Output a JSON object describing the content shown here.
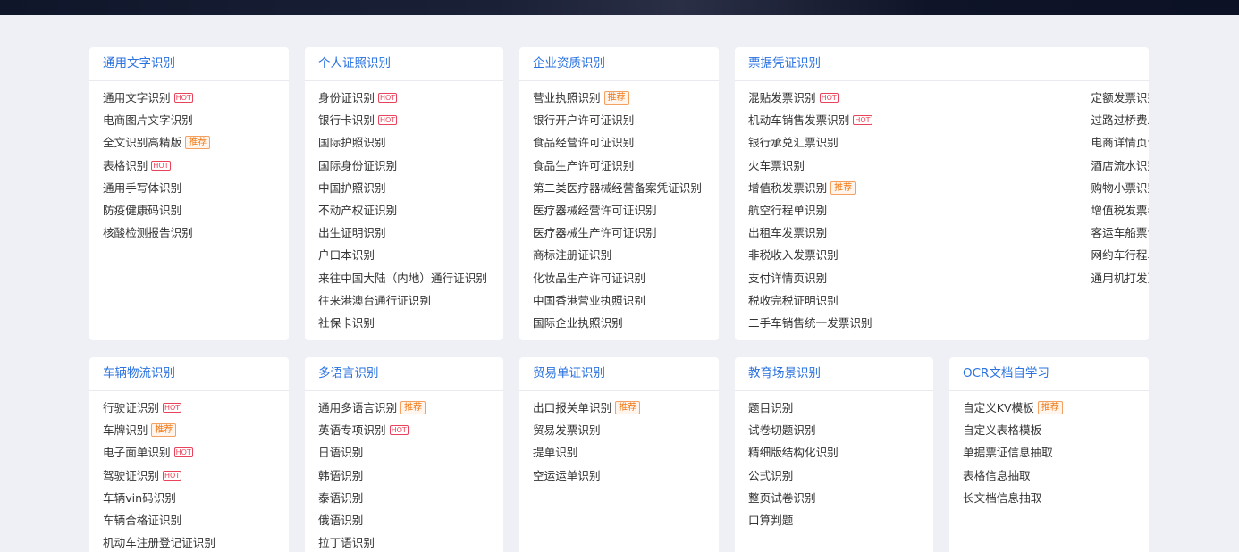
{
  "colors": {
    "accent": "#2a72e0",
    "hot": "#e8435a",
    "recommend": "#f07a18",
    "background": "#eef0f5"
  },
  "cards": [
    {
      "title": "通用文字识别",
      "columns": [
        [
          {
            "label": "通用文字识别",
            "badge": "HOT"
          },
          {
            "label": "电商图片文字识别"
          },
          {
            "label": "全文识别高精版",
            "badge": "推荐"
          },
          {
            "label": "表格识别",
            "badge": "HOT"
          },
          {
            "label": "通用手写体识别"
          },
          {
            "label": "防疫健康码识别"
          },
          {
            "label": "核酸检测报告识别"
          }
        ]
      ]
    },
    {
      "title": "个人证照识别",
      "columns": [
        [
          {
            "label": "身份证识别",
            "badge": "HOT"
          },
          {
            "label": "银行卡识别",
            "badge": "HOT"
          },
          {
            "label": "国际护照识别"
          },
          {
            "label": "国际身份证识别"
          },
          {
            "label": "中国护照识别"
          },
          {
            "label": "不动产权证识别"
          },
          {
            "label": "出生证明识别"
          },
          {
            "label": "户口本识别"
          },
          {
            "label": "来往中国大陆（内地）通行证识别"
          },
          {
            "label": "往来港澳台通行证识别"
          },
          {
            "label": "社保卡识别"
          }
        ]
      ]
    },
    {
      "title": "企业资质识别",
      "columns": [
        [
          {
            "label": "营业执照识别",
            "badge": "推荐"
          },
          {
            "label": "银行开户许可证识别"
          },
          {
            "label": "食品经营许可证识别"
          },
          {
            "label": "食品生产许可证识别"
          },
          {
            "label": "第二类医疗器械经营备案凭证识别"
          },
          {
            "label": "医疗器械经营许可证识别"
          },
          {
            "label": "医疗器械生产许可证识别"
          },
          {
            "label": "商标注册证识别"
          },
          {
            "label": "化妆品生产许可证识别"
          },
          {
            "label": "中国香港营业执照识别"
          },
          {
            "label": "国际企业执照识别"
          }
        ]
      ]
    },
    {
      "title": "票据凭证识别",
      "columns": [
        [
          {
            "label": "混贴发票识别",
            "badge": "HOT"
          },
          {
            "label": "机动车销售发票识别",
            "badge": "HOT"
          },
          {
            "label": "银行承兑汇票识别"
          },
          {
            "label": "火车票识别"
          },
          {
            "label": "增值税发票识别",
            "badge": "推荐"
          },
          {
            "label": "航空行程单识别"
          },
          {
            "label": "出租车发票识别"
          },
          {
            "label": "非税收入发票识别"
          },
          {
            "label": "支付详情页识别"
          },
          {
            "label": "税收完税证明识别"
          },
          {
            "label": "二手车销售统一发票识别"
          }
        ],
        [
          {
            "label": "定额发票识别"
          },
          {
            "label": "过路过桥费发票识别"
          },
          {
            "label": "电商详情页识别"
          },
          {
            "label": "酒店流水识别"
          },
          {
            "label": "购物小票识别"
          },
          {
            "label": "增值税发票卷票识别"
          },
          {
            "label": "客运车船票识别"
          },
          {
            "label": "网约车行程单识别"
          },
          {
            "label": "通用机打发票识别"
          }
        ]
      ]
    },
    {
      "title": "车辆物流识别",
      "columns": [
        [
          {
            "label": "行驶证识别",
            "badge": "HOT"
          },
          {
            "label": "车牌识别",
            "badge": "推荐"
          },
          {
            "label": "电子面单识别",
            "badge": "HOT"
          },
          {
            "label": "驾驶证识别",
            "badge": "HOT"
          },
          {
            "label": "车辆vin码识别"
          },
          {
            "label": "车辆合格证识别"
          },
          {
            "label": "机动车注册登记证识别"
          }
        ]
      ]
    },
    {
      "title": "多语言识别",
      "columns": [
        [
          {
            "label": "通用多语言识别",
            "badge": "推荐"
          },
          {
            "label": "英语专项识别",
            "badge": "HOT"
          },
          {
            "label": "日语识别"
          },
          {
            "label": "韩语识别"
          },
          {
            "label": "泰语识别"
          },
          {
            "label": "俄语识别"
          },
          {
            "label": "拉丁语识别"
          }
        ]
      ]
    },
    {
      "title": "贸易单证识别",
      "columns": [
        [
          {
            "label": "出口报关单识别",
            "badge": "推荐"
          },
          {
            "label": "贸易发票识别"
          },
          {
            "label": "提单识别"
          },
          {
            "label": "空运运单识别"
          }
        ]
      ]
    },
    {
      "title": "教育场景识别",
      "columns": [
        [
          {
            "label": "题目识别"
          },
          {
            "label": "试卷切题识别"
          },
          {
            "label": "精细版结构化识别"
          },
          {
            "label": "公式识别"
          },
          {
            "label": "整页试卷识别"
          },
          {
            "label": "口算判题"
          }
        ]
      ]
    },
    {
      "title": "OCR文档自学习",
      "columns": [
        [
          {
            "label": "自定义KV模板",
            "badge": "推荐"
          },
          {
            "label": "自定义表格模板"
          },
          {
            "label": "单据票证信息抽取"
          },
          {
            "label": "表格信息抽取"
          },
          {
            "label": "长文档信息抽取"
          }
        ]
      ]
    }
  ]
}
